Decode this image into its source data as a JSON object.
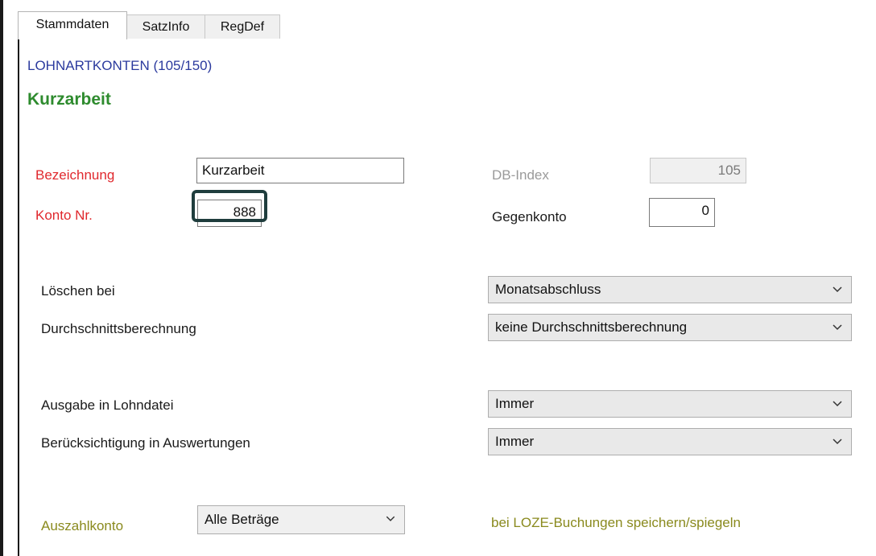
{
  "tabs": [
    "Stammdaten",
    "SatzInfo",
    "RegDef"
  ],
  "section_title": "LOHNARTKONTEN (105/150)",
  "record_title": "Kurzarbeit",
  "fields": {
    "bezeichnung": {
      "label": "Bezeichnung",
      "value": "Kurzarbeit"
    },
    "konto_nr": {
      "label": "Konto Nr.",
      "value": "888"
    },
    "db_index": {
      "label": "DB-Index",
      "value": "105"
    },
    "gegenkonto": {
      "label": "Gegenkonto",
      "value": "0"
    }
  },
  "dropdowns": {
    "loeschen_bei": {
      "label": "Löschen bei",
      "value": "Monatsabschluss"
    },
    "durchschnitt": {
      "label": "Durchschnittsberechnung",
      "value": "keine Durchschnittsberechnung"
    },
    "ausgabe": {
      "label": "Ausgabe in Lohndatei",
      "value": "Immer"
    },
    "auswertungen": {
      "label": "Berücksichtigung in Auswertungen",
      "value": "Immer"
    },
    "auszahlkonto": {
      "label": "Auszahlkonto",
      "value": "Alle Beträge"
    }
  },
  "loze_text": "bei LOZE-Buchungen speichern/spiegeln",
  "colors": {
    "required_label": "#e0282d",
    "section_title": "#2b3a9e",
    "record_title": "#2e8b2e",
    "olive_label": "#8a8a1e",
    "highlight": "#1f3d3d"
  },
  "icons": {
    "dropdown": "chevron-down-icon"
  }
}
